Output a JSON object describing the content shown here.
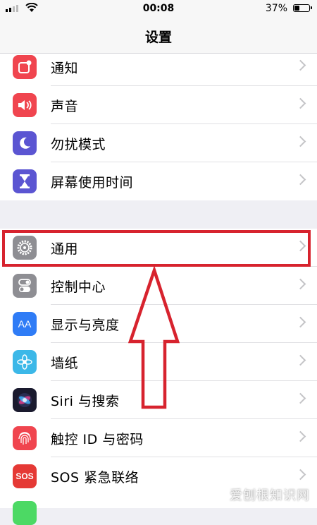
{
  "status_bar": {
    "time": "00:08",
    "battery_percent": "37%",
    "battery_level": 0.37
  },
  "nav": {
    "title": "设置"
  },
  "group1": [
    {
      "label": "通知",
      "icon": "notifications-icon",
      "color": "#f0454f"
    },
    {
      "label": "声音",
      "icon": "sound-icon",
      "color": "#f0454f"
    },
    {
      "label": "勿扰模式",
      "icon": "moon-icon",
      "color": "#5b55d2"
    },
    {
      "label": "屏幕使用时间",
      "icon": "hourglass-icon",
      "color": "#5b55d2"
    }
  ],
  "group2": [
    {
      "label": "通用",
      "icon": "gear-icon",
      "color": "#8e8e93"
    },
    {
      "label": "控制中心",
      "icon": "toggles-icon",
      "color": "#8e8e93"
    },
    {
      "label": "显示与亮度",
      "icon": "text-size-icon",
      "color": "#2f7cf6"
    },
    {
      "label": "墙纸",
      "icon": "flower-icon",
      "color": "#3cb8e8"
    },
    {
      "label": "Siri 与搜索",
      "icon": "siri-icon",
      "color": "#1a1a2e"
    },
    {
      "label": "触控 ID 与密码",
      "icon": "fingerprint-icon",
      "color": "#f0454f"
    },
    {
      "label": "SOS 紧急联络",
      "icon": "sos-icon",
      "color": "#e53935"
    }
  ],
  "icons": {
    "sos_text": "SOS",
    "aa_text": "AA"
  },
  "highlight_color": "#d7232e",
  "watermark": "爱刨根知识网"
}
